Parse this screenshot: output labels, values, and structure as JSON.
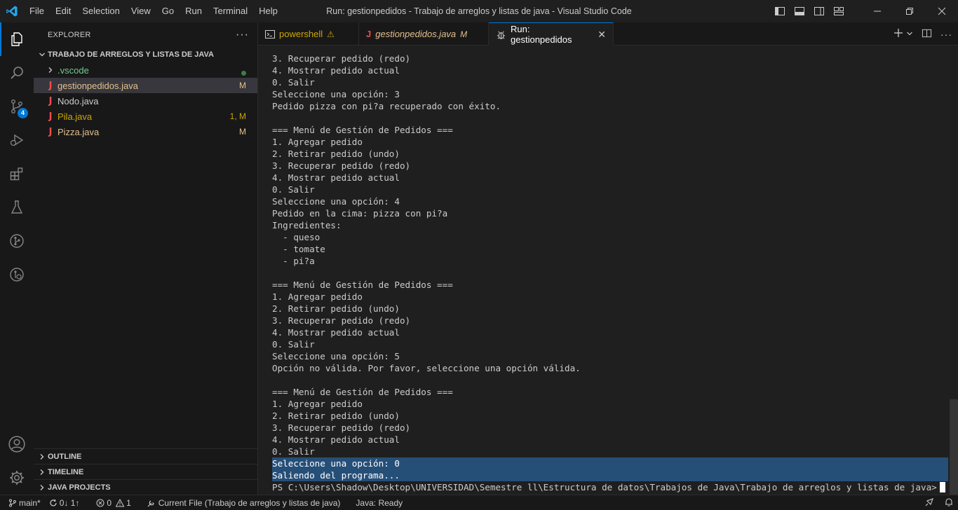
{
  "window": {
    "title": "Run: gestionpedidos - Trabajo de arreglos y listas de java - Visual Studio Code",
    "menu": [
      "File",
      "Edit",
      "Selection",
      "View",
      "Go",
      "Run",
      "Terminal",
      "Help"
    ]
  },
  "activity_bar": {
    "source_control_badge": "4"
  },
  "sidebar": {
    "header": "EXPLORER",
    "more": "···",
    "folder_title": "TRABAJO DE ARREGLOS Y LISTAS DE JAVA",
    "items": [
      {
        "label": ".vscode",
        "decoration": "",
        "color": "#73c991"
      },
      {
        "label": "gestionpedidos.java",
        "decoration": "M",
        "color": "#e2c08d"
      },
      {
        "label": "Nodo.java",
        "decoration": "",
        "color": "#cccccc"
      },
      {
        "label": "Pila.java",
        "decoration": "1, M",
        "color": "#cca700"
      },
      {
        "label": "Pizza.java",
        "decoration": "M",
        "color": "#e2c08d"
      }
    ],
    "sections": [
      "OUTLINE",
      "TIMELINE",
      "JAVA PROJECTS"
    ]
  },
  "tabs": [
    {
      "label": "powershell",
      "mark": "⚠",
      "active": false
    },
    {
      "label": "gestionpedidos.java",
      "mark": "M",
      "active": false
    },
    {
      "label": "Run: gestionpedidos",
      "mark": "✕",
      "active": true
    }
  ],
  "terminal": {
    "lines": [
      "3. Recuperar pedido (redo)",
      "4. Mostrar pedido actual",
      "0. Salir",
      "Seleccione una opción: 3",
      "Pedido pizza con pi?a recuperado con éxito.",
      "",
      "=== Menú de Gestión de Pedidos ===",
      "1. Agregar pedido",
      "2. Retirar pedido (undo)",
      "3. Recuperar pedido (redo)",
      "4. Mostrar pedido actual",
      "0. Salir",
      "Seleccione una opción: 4",
      "Pedido en la cima: pizza con pi?a",
      "Ingredientes:",
      "  - queso",
      "  - tomate",
      "  - pi?a",
      "",
      "=== Menú de Gestión de Pedidos ===",
      "1. Agregar pedido",
      "2. Retirar pedido (undo)",
      "3. Recuperar pedido (redo)",
      "4. Mostrar pedido actual",
      "0. Salir",
      "Seleccione una opción: 5",
      "Opción no válida. Por favor, seleccione una opción válida.",
      "",
      "=== Menú de Gestión de Pedidos ===",
      "1. Agregar pedido",
      "2. Retirar pedido (undo)",
      "3. Recuperar pedido (redo)",
      "4. Mostrar pedido actual",
      "0. Salir",
      "Seleccione una opción: 0",
      "Saliendo del programa...",
      "PS C:\\Users\\Shadow\\Desktop\\UNIVERSIDAD\\Semestre ll\\Estructura de datos\\Trabajos de Java\\Trabajo de arreglos y listas de java>"
    ],
    "selected_lines": [
      34,
      35
    ]
  },
  "status": {
    "branch": "main*",
    "sync": "0↓ 1↑",
    "errors": "0",
    "warnings": "1",
    "current_file": "Current File (Trabajo de arreglos y listas de java)",
    "java": "Java: Ready"
  },
  "colors": {
    "accent": "#0078d4",
    "java_icon": "#f14c4c",
    "selection": "#264f78"
  }
}
